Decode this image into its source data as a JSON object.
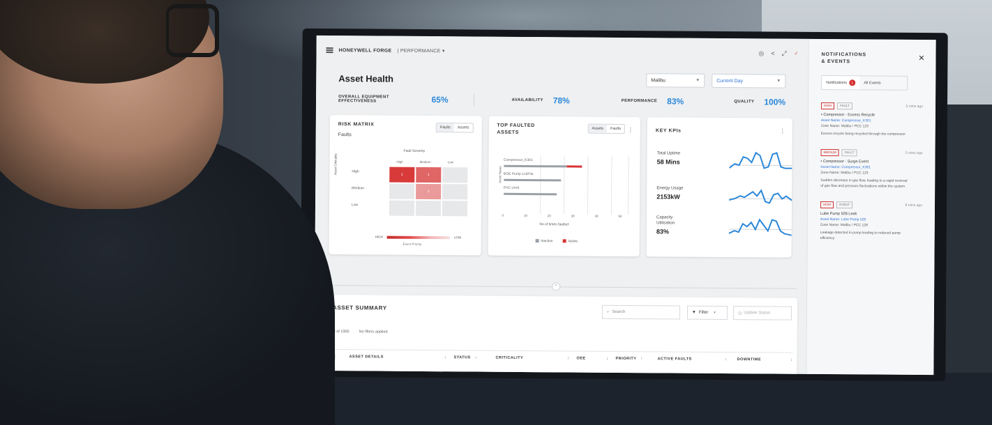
{
  "header": {
    "brand": "HONEYWELL FORGE",
    "product": "PERFORMANCE",
    "icons": [
      "help-icon",
      "share-icon",
      "expand-icon",
      "alert-icon"
    ]
  },
  "page": {
    "title": "Asset Health",
    "site_select": "Malibu",
    "period_select": "Current Day"
  },
  "metrics": [
    {
      "label": "OVERALL EQUIPMENT EFFECTIVENESS",
      "value": "65%"
    },
    {
      "label": "AVAILABILITY",
      "value": "78%"
    },
    {
      "label": "PERFORMANCE",
      "value": "83%"
    },
    {
      "label": "QUALITY",
      "value": "100%"
    }
  ],
  "risk_matrix": {
    "title": "RISK MATRIX",
    "toggle": [
      "Faults",
      "Assets"
    ],
    "subtitle": "Faults",
    "severity_label": "Fault Severity",
    "columns": [
      "High",
      "Medium",
      "Low"
    ],
    "rows": [
      "High",
      "Medium",
      "Low"
    ],
    "axis_label": "Asset Criticality",
    "cells": [
      [
        "1",
        "1",
        ""
      ],
      [
        "",
        "1",
        ""
      ],
      [
        "",
        "",
        ""
      ]
    ],
    "scale_high": "HIGH",
    "scale_low": "LOW",
    "scale_caption": "Event Priority"
  },
  "top_faulted": {
    "title_line1": "TOP FAULTED",
    "title_line2": "ASSETS",
    "toggle": [
      "Assets",
      "Faults"
    ],
    "assets": [
      "Compressor_K301",
      "BOE Pump 1x5Fsk",
      "PVC Urnit"
    ],
    "y_label": "Asset Name",
    "x_ticks": [
      "0",
      "10",
      "20",
      "30",
      "40",
      "50"
    ],
    "x_label": "No of times faulted",
    "legend": [
      "Inactive",
      "Active"
    ]
  },
  "key_kpis": {
    "title": "KEY KPIs",
    "items": [
      {
        "label_line1": "Total Uptime",
        "label_line2": "",
        "value": "58 Mins"
      },
      {
        "label_line1": "Energy Usage",
        "label_line2": "",
        "value": "2153kW"
      },
      {
        "label_line1": "Capacity",
        "label_line2": "Utilization",
        "value": "83%"
      }
    ]
  },
  "asset_summary": {
    "title": "ASSET SUMMARY",
    "search_placeholder": "Search",
    "filter_label": "Filter",
    "update_label": "Update Status",
    "count": "1-3 of 1000",
    "filters_applied": "No filters applied",
    "columns": [
      "ASSET DETAILS",
      "STATUS",
      "CRITICALITY",
      "OEE",
      "PRIORITY",
      "ACTIVE FAULTS",
      "DOWNTIME"
    ]
  },
  "notifications": {
    "title_line1": "NOTIFICATIONS",
    "title_line2": "& EVENTS",
    "tab_notifications": "Notifications",
    "badge_count": "1",
    "tab_all": "All Events",
    "items": [
      {
        "tag": "HIGH",
        "tag2": "FAULT",
        "time": "5 mins ago",
        "subject": "Compressor - Excess Recycle",
        "link": "Asset Name: Compressor_K301",
        "meta": "Zone Name: Malibu / PCC 123",
        "desc": "Excess recycle being recycled through the compressor"
      },
      {
        "tag": "MEDIUM",
        "tag2": "FAULT",
        "time": "5 mins ago",
        "subject": "Compressor - Surge Event",
        "link": "Asset Name: Compressor_K301",
        "meta": "Zone Name: Malibu / PCC 123",
        "desc": "Sudden decrease in gas flow, leading to a rapid reversal of gas flow and pressure fluctuations within the system"
      },
      {
        "tag": "HIGH",
        "tag2": "EVENT",
        "time": "8 mins ago",
        "subject": "Lube Pump 528 Leak",
        "link": "Asset Name: Lube Pump 528",
        "meta": "Zone Name: Malibu / PCC 128",
        "desc": "Leakage detected in pump leading to reduced pump efficiency"
      }
    ]
  },
  "colors": {
    "accent": "#2b87d8",
    "alert": "#d32f2f",
    "matrix_high": "#d83a3a",
    "matrix_mid": "#ea9a9a"
  }
}
